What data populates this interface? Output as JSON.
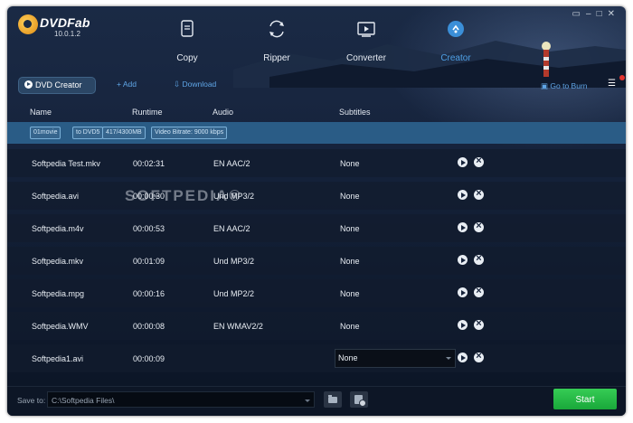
{
  "app": {
    "name": "DVDFab",
    "version": "10.0.1.2",
    "window_controls": [
      "▭",
      "–",
      "□",
      "✕"
    ]
  },
  "tabs": [
    {
      "label": "Copy",
      "icon": "copy-icon",
      "active": false
    },
    {
      "label": "Ripper",
      "icon": "ripper-icon",
      "active": false
    },
    {
      "label": "Converter",
      "icon": "converter-icon",
      "active": false
    },
    {
      "label": "Creator",
      "icon": "creator-icon",
      "active": true
    }
  ],
  "toolbar": {
    "mode_label": "DVD Creator",
    "add_label": "Add",
    "download_label": "Download",
    "burn_label": "Go to Burn",
    "menu_icon": "list-icon"
  },
  "columns": {
    "name": "Name",
    "runtime": "Runtime",
    "audio": "Audio",
    "subtitles": "Subtitles"
  },
  "info_chips": [
    "01movie",
    "to DVD5",
    "417/4300MB",
    "Video Bitrate: 9000 kbps"
  ],
  "rows": [
    {
      "name": "Softpedia Test.mkv",
      "runtime": "00:02:31",
      "audio": "EN  AAC/2",
      "subtitles": "None"
    },
    {
      "name": "Softpedia.avi",
      "runtime": "00:00:30",
      "audio": "Und  MP3/2",
      "subtitles": "None"
    },
    {
      "name": "Softpedia.m4v",
      "runtime": "00:00:53",
      "audio": "EN  AAC/2",
      "subtitles": "None"
    },
    {
      "name": "Softpedia.mkv",
      "runtime": "00:01:09",
      "audio": "Und  MP3/2",
      "subtitles": "None"
    },
    {
      "name": "Softpedia.mpg",
      "runtime": "00:00:16",
      "audio": "Und  MP2/2",
      "subtitles": "None"
    },
    {
      "name": "Softpedia.WMV",
      "runtime": "00:00:08",
      "audio": "EN  WMAV2/2",
      "subtitles": "None"
    },
    {
      "name": "Softpedia1.avi",
      "runtime": "00:00:09",
      "audio": "",
      "subtitles": "None",
      "subtitle_dropdown": true
    }
  ],
  "watermark": "SOFTPEDIA®",
  "footer": {
    "save_to_label": "Save to:",
    "save_path": "C:\\Softpedia Files\\",
    "start_label": "Start",
    "folder_icon": "folder-icon",
    "iso_icon": "iso-icon"
  },
  "colors": {
    "accent": "#4ea0e6",
    "info_bar": "#2a5c86",
    "start": "#22b443"
  }
}
